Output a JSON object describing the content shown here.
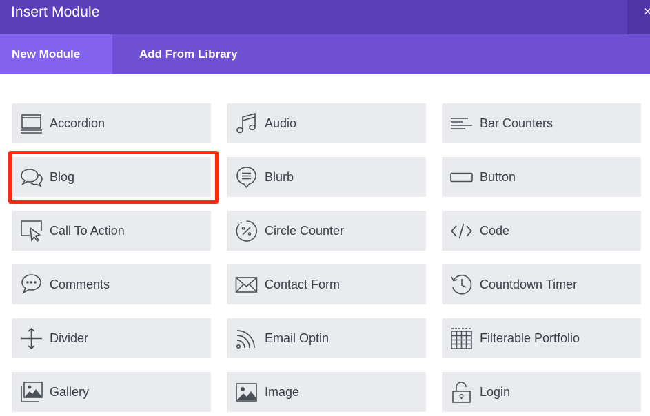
{
  "window": {
    "title": "Insert Module",
    "close_label": "×"
  },
  "tabs": [
    {
      "label": "New Module",
      "active": true
    },
    {
      "label": "Add From Library",
      "active": false
    }
  ],
  "colors": {
    "titlebar": "#5b3fb8",
    "tabbar": "#7050d2",
    "active_tab": "#8463ee",
    "module_bg": "#e9ebee",
    "highlight": "#ff2a12"
  },
  "modules": [
    {
      "label": "Accordion",
      "icon": "accordion-icon"
    },
    {
      "label": "Audio",
      "icon": "music-note-icon"
    },
    {
      "label": "Bar Counters",
      "icon": "bar-counters-icon"
    },
    {
      "label": "Blog",
      "icon": "speech-bubbles-icon"
    },
    {
      "label": "Blurb",
      "icon": "blurb-icon"
    },
    {
      "label": "Button",
      "icon": "button-icon"
    },
    {
      "label": "Call To Action",
      "icon": "call-to-action-icon"
    },
    {
      "label": "Circle Counter",
      "icon": "circle-counter-icon"
    },
    {
      "label": "Code",
      "icon": "code-icon"
    },
    {
      "label": "Comments",
      "icon": "comments-icon"
    },
    {
      "label": "Contact Form",
      "icon": "envelope-icon"
    },
    {
      "label": "Countdown Timer",
      "icon": "countdown-timer-icon"
    },
    {
      "label": "Divider",
      "icon": "divider-icon"
    },
    {
      "label": "Email Optin",
      "icon": "rss-icon"
    },
    {
      "label": "Filterable Portfolio",
      "icon": "grid-icon"
    },
    {
      "label": "Gallery",
      "icon": "gallery-icon"
    },
    {
      "label": "Image",
      "icon": "image-icon"
    },
    {
      "label": "Login",
      "icon": "padlock-icon"
    }
  ],
  "highlighted_module": "Blog"
}
